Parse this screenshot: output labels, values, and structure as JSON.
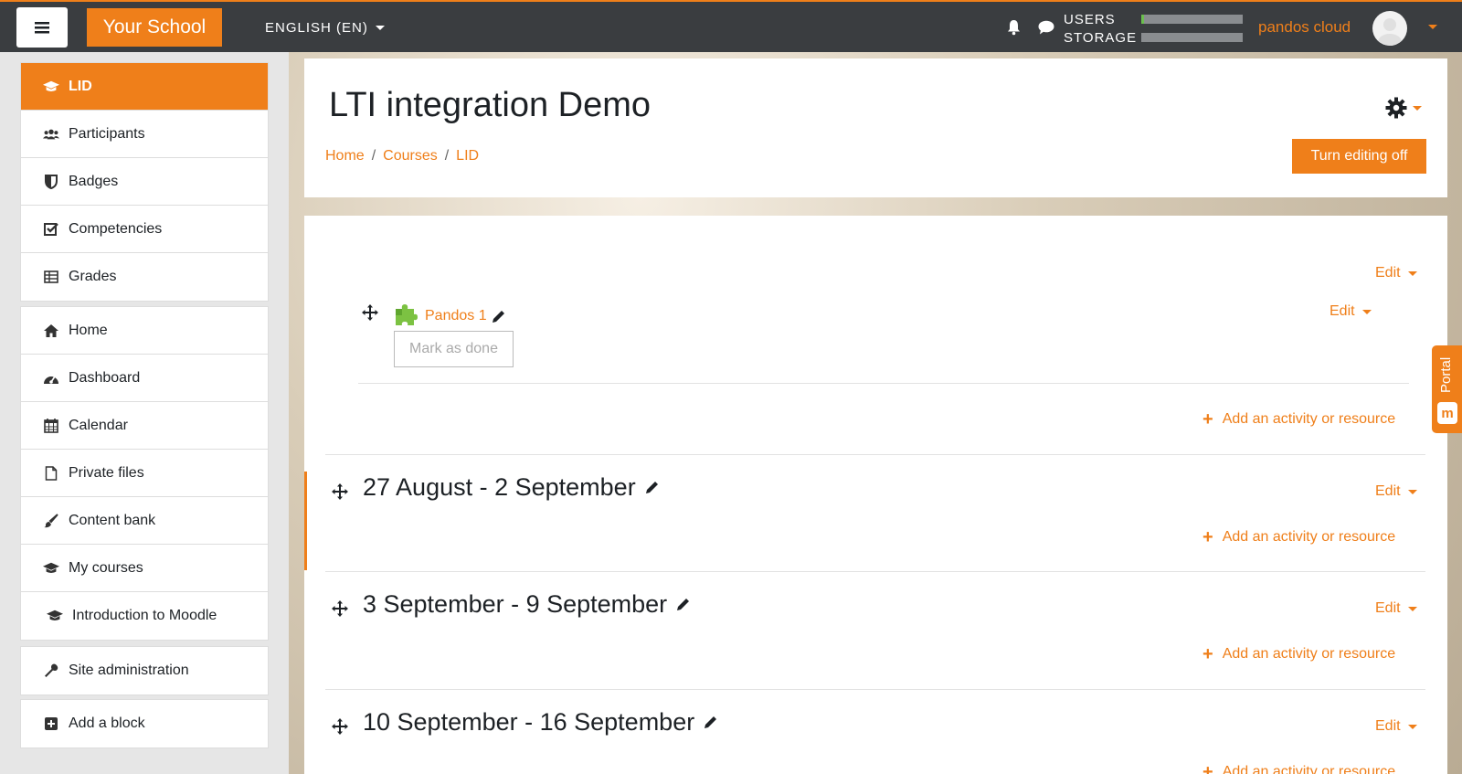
{
  "topbar": {
    "brand": "Your School",
    "language": "ENGLISH (EN)",
    "usage_users": "USERS",
    "usage_storage": "STORAGE",
    "cloud_name": "pandos cloud"
  },
  "drawer": {
    "course_items": [
      {
        "label": "LID",
        "icon": "graduation-cap-icon",
        "active": true
      },
      {
        "label": "Participants",
        "icon": "users-icon"
      },
      {
        "label": "Badges",
        "icon": "shield-icon"
      },
      {
        "label": "Competencies",
        "icon": "check-square-icon"
      },
      {
        "label": "Grades",
        "icon": "table-icon"
      }
    ],
    "site_items": [
      {
        "label": "Home",
        "icon": "home-icon"
      },
      {
        "label": "Dashboard",
        "icon": "dashboard-icon"
      },
      {
        "label": "Calendar",
        "icon": "calendar-icon"
      },
      {
        "label": "Private files",
        "icon": "file-icon"
      },
      {
        "label": "Content bank",
        "icon": "brush-icon"
      },
      {
        "label": "My courses",
        "icon": "graduation-cap-icon"
      },
      {
        "label": "Introduction to Moodle",
        "icon": "graduation-cap-icon"
      }
    ],
    "admin_label": "Site administration",
    "add_block_label": "Add a block"
  },
  "header": {
    "title": "LTI integration Demo",
    "breadcrumb": [
      "Home",
      "Courses",
      "LID"
    ],
    "editing_button": "Turn editing off"
  },
  "main": {
    "edit_label": "Edit",
    "add_activity_label": "Add an activity or resource",
    "activity": {
      "name": "Pandos 1",
      "mark_done": "Mark as done"
    },
    "sections": [
      {
        "title": "27 August - 2 September"
      },
      {
        "title": "3 September - 9 September"
      },
      {
        "title": "10 September - 16 September"
      }
    ]
  },
  "portal_tab": "Portal",
  "colors": {
    "accent": "#ef7f1a",
    "topbar": "#3a3d40"
  }
}
